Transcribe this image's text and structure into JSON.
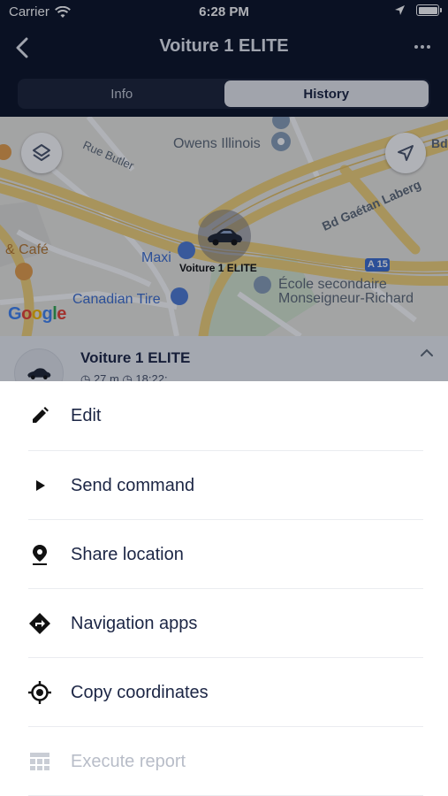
{
  "status_bar": {
    "carrier": "Carrier",
    "time": "6:28 PM"
  },
  "nav": {
    "title": "Voiture 1 ELITE"
  },
  "tabs": [
    {
      "label": "Info",
      "active": false
    },
    {
      "label": "History",
      "active": true
    }
  ],
  "map": {
    "labels": {
      "owens": "Owens Illinois",
      "rue_butler": "Rue Butler",
      "bd_gaetan": "Bd Gaétan Laberg",
      "bd_edge": "Bd",
      "cafe": "& Café",
      "maxi": "Maxi",
      "canadian_tire": "Canadian Tire",
      "ecole_1": "École secondaire",
      "ecole_2": "Monseigneur-Richard",
      "a15": "A 15",
      "google": "Google"
    },
    "car_label": "Voiture 1 ELITE"
  },
  "object": {
    "name": "Voiture 1 ELITE",
    "subtitle": "◷ 27 m   ◷ 18:22:"
  },
  "actions": [
    {
      "label": "Edit",
      "icon": "pencil-icon",
      "enabled": true
    },
    {
      "label": "Send command",
      "icon": "play-icon",
      "enabled": true
    },
    {
      "label": "Share location",
      "icon": "location-pin-icon",
      "enabled": true
    },
    {
      "label": "Navigation apps",
      "icon": "directions-icon",
      "enabled": true
    },
    {
      "label": "Copy coordinates",
      "icon": "crosshair-icon",
      "enabled": true
    },
    {
      "label": "Execute report",
      "icon": "table-icon",
      "enabled": false
    }
  ],
  "colors": {
    "header_bg": "#0b1226",
    "text_primary": "#1c2645",
    "disabled_text": "#b8bdc8",
    "road_yellow": "#f3d37a"
  }
}
